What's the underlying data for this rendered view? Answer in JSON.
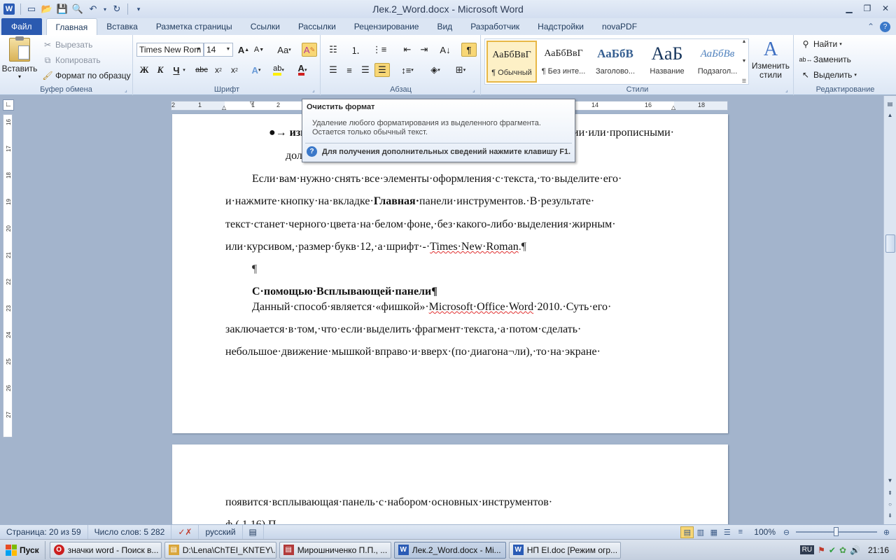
{
  "window": {
    "title": "Лек.2_Word.docx - Microsoft Word",
    "app_icon": "W"
  },
  "tabs": [
    {
      "label": "Файл"
    },
    {
      "label": "Главная"
    },
    {
      "label": "Вставка"
    },
    {
      "label": "Разметка страницы"
    },
    {
      "label": "Ссылки"
    },
    {
      "label": "Рассылки"
    },
    {
      "label": "Рецензирование"
    },
    {
      "label": "Вид"
    },
    {
      "label": "Разработчик"
    },
    {
      "label": "Надстройки"
    },
    {
      "label": "novaPDF"
    }
  ],
  "clipboard": {
    "label": "Буфер обмена",
    "paste": "Вставить",
    "cut": "Вырезать",
    "copy": "Копировать",
    "format_painter": "Формат по образцу"
  },
  "font": {
    "label": "Шрифт",
    "family": "Times New Rom",
    "size": "14"
  },
  "paragraph": {
    "label": "Абзац"
  },
  "styles": {
    "label": "Стили",
    "items": [
      {
        "preview": "АаБбВвГ",
        "name": "¶ Обычный"
      },
      {
        "preview": "АаБбВвГ",
        "name": "¶ Без инте..."
      },
      {
        "preview": "АаБбВ",
        "name": "Заголово..."
      },
      {
        "preview": "АаБ",
        "name": "Название"
      },
      {
        "preview": "АаБбВв",
        "name": "Подзагол..."
      }
    ],
    "change_styles": "Изменить стили"
  },
  "editing": {
    "label": "Редактирование",
    "find": "Найти",
    "replace": "Заменить",
    "select": "Выделить"
  },
  "tooltip": {
    "title": "Очистить формат",
    "body": "Удаление любого форматирования из выделенного фрагмента.\nОстается только обычный текст.",
    "help": "Для получения дополнительных сведений нажмите клавишу F1."
  },
  "ruler": {
    "h_marks": [
      "2",
      "1",
      "1",
      "2",
      "14",
      "16",
      "18"
    ],
    "v_marks": [
      "16",
      "17",
      "18",
      "19",
      "20",
      "21",
      "22",
      "23",
      "24",
      "25",
      "26",
      "27"
    ]
  },
  "document": {
    "bullet_partial": "●→ изм",
    "bullet_right": "ии·или·прописными·",
    "bullet_line2": "дол",
    "p1": [
      "Если·вам·нужно·снять·все·элементы·оформления·с·текста,·то·выделите·его·",
      "и·нажмите·кнопку·на·вкладке·",
      "Главная·",
      "панели·инструментов.·В·результате·",
      "текст·станет·черного·цвета·на·белом·фоне,·без·какого-либо·выделения·жирным·",
      "или·курсивом,·размер·букв·12,·а·шрифт·-·",
      "Times·New·Roman",
      ".¶"
    ],
    "empty_para": "¶",
    "heading": "С·помощью·Всплывающей·панели",
    "heading_mark": "¶",
    "p2": [
      "Данный·способ·является·«фишкой»·",
      "Microsoft·Office·Word",
      "·2010.·Суть·его·",
      "заключается·в·том,·что·если·выделить·фрагмент·текста,·а·потом·сделать·",
      "небольшое·движение·мышкой·вправо·и·вверх·(по·диагона¬ли),·то·на·экране·"
    ],
    "p3": "появится·всплывающая·панель·с·набором·основных·инструментов·",
    "p3_cut": "ф                                  (   1 16)   П"
  },
  "status": {
    "page": "Страница: 20 из 59",
    "words": "Число слов: 5 282",
    "language": "русский",
    "zoom": "100%"
  },
  "taskbar": {
    "start": "Пуск",
    "items": [
      {
        "label": "значки word - Поиск в...",
        "icon": "O",
        "color": "#cc1f1f"
      },
      {
        "label": "D:\\Lena\\ChTEI_KNTEY\\...",
        "icon": "▤",
        "color": "#d9a53a"
      },
      {
        "label": "Мирошниченко П.П., ...",
        "icon": "▤",
        "color": "#b23a3a"
      },
      {
        "label": "Лек.2_Word.docx - Mi...",
        "icon": "W",
        "color": "#2a5bb5"
      },
      {
        "label": "НП EI.doc [Режим огр...",
        "icon": "W",
        "color": "#2a5bb5"
      }
    ],
    "lang": "RU",
    "time": "21:16"
  }
}
